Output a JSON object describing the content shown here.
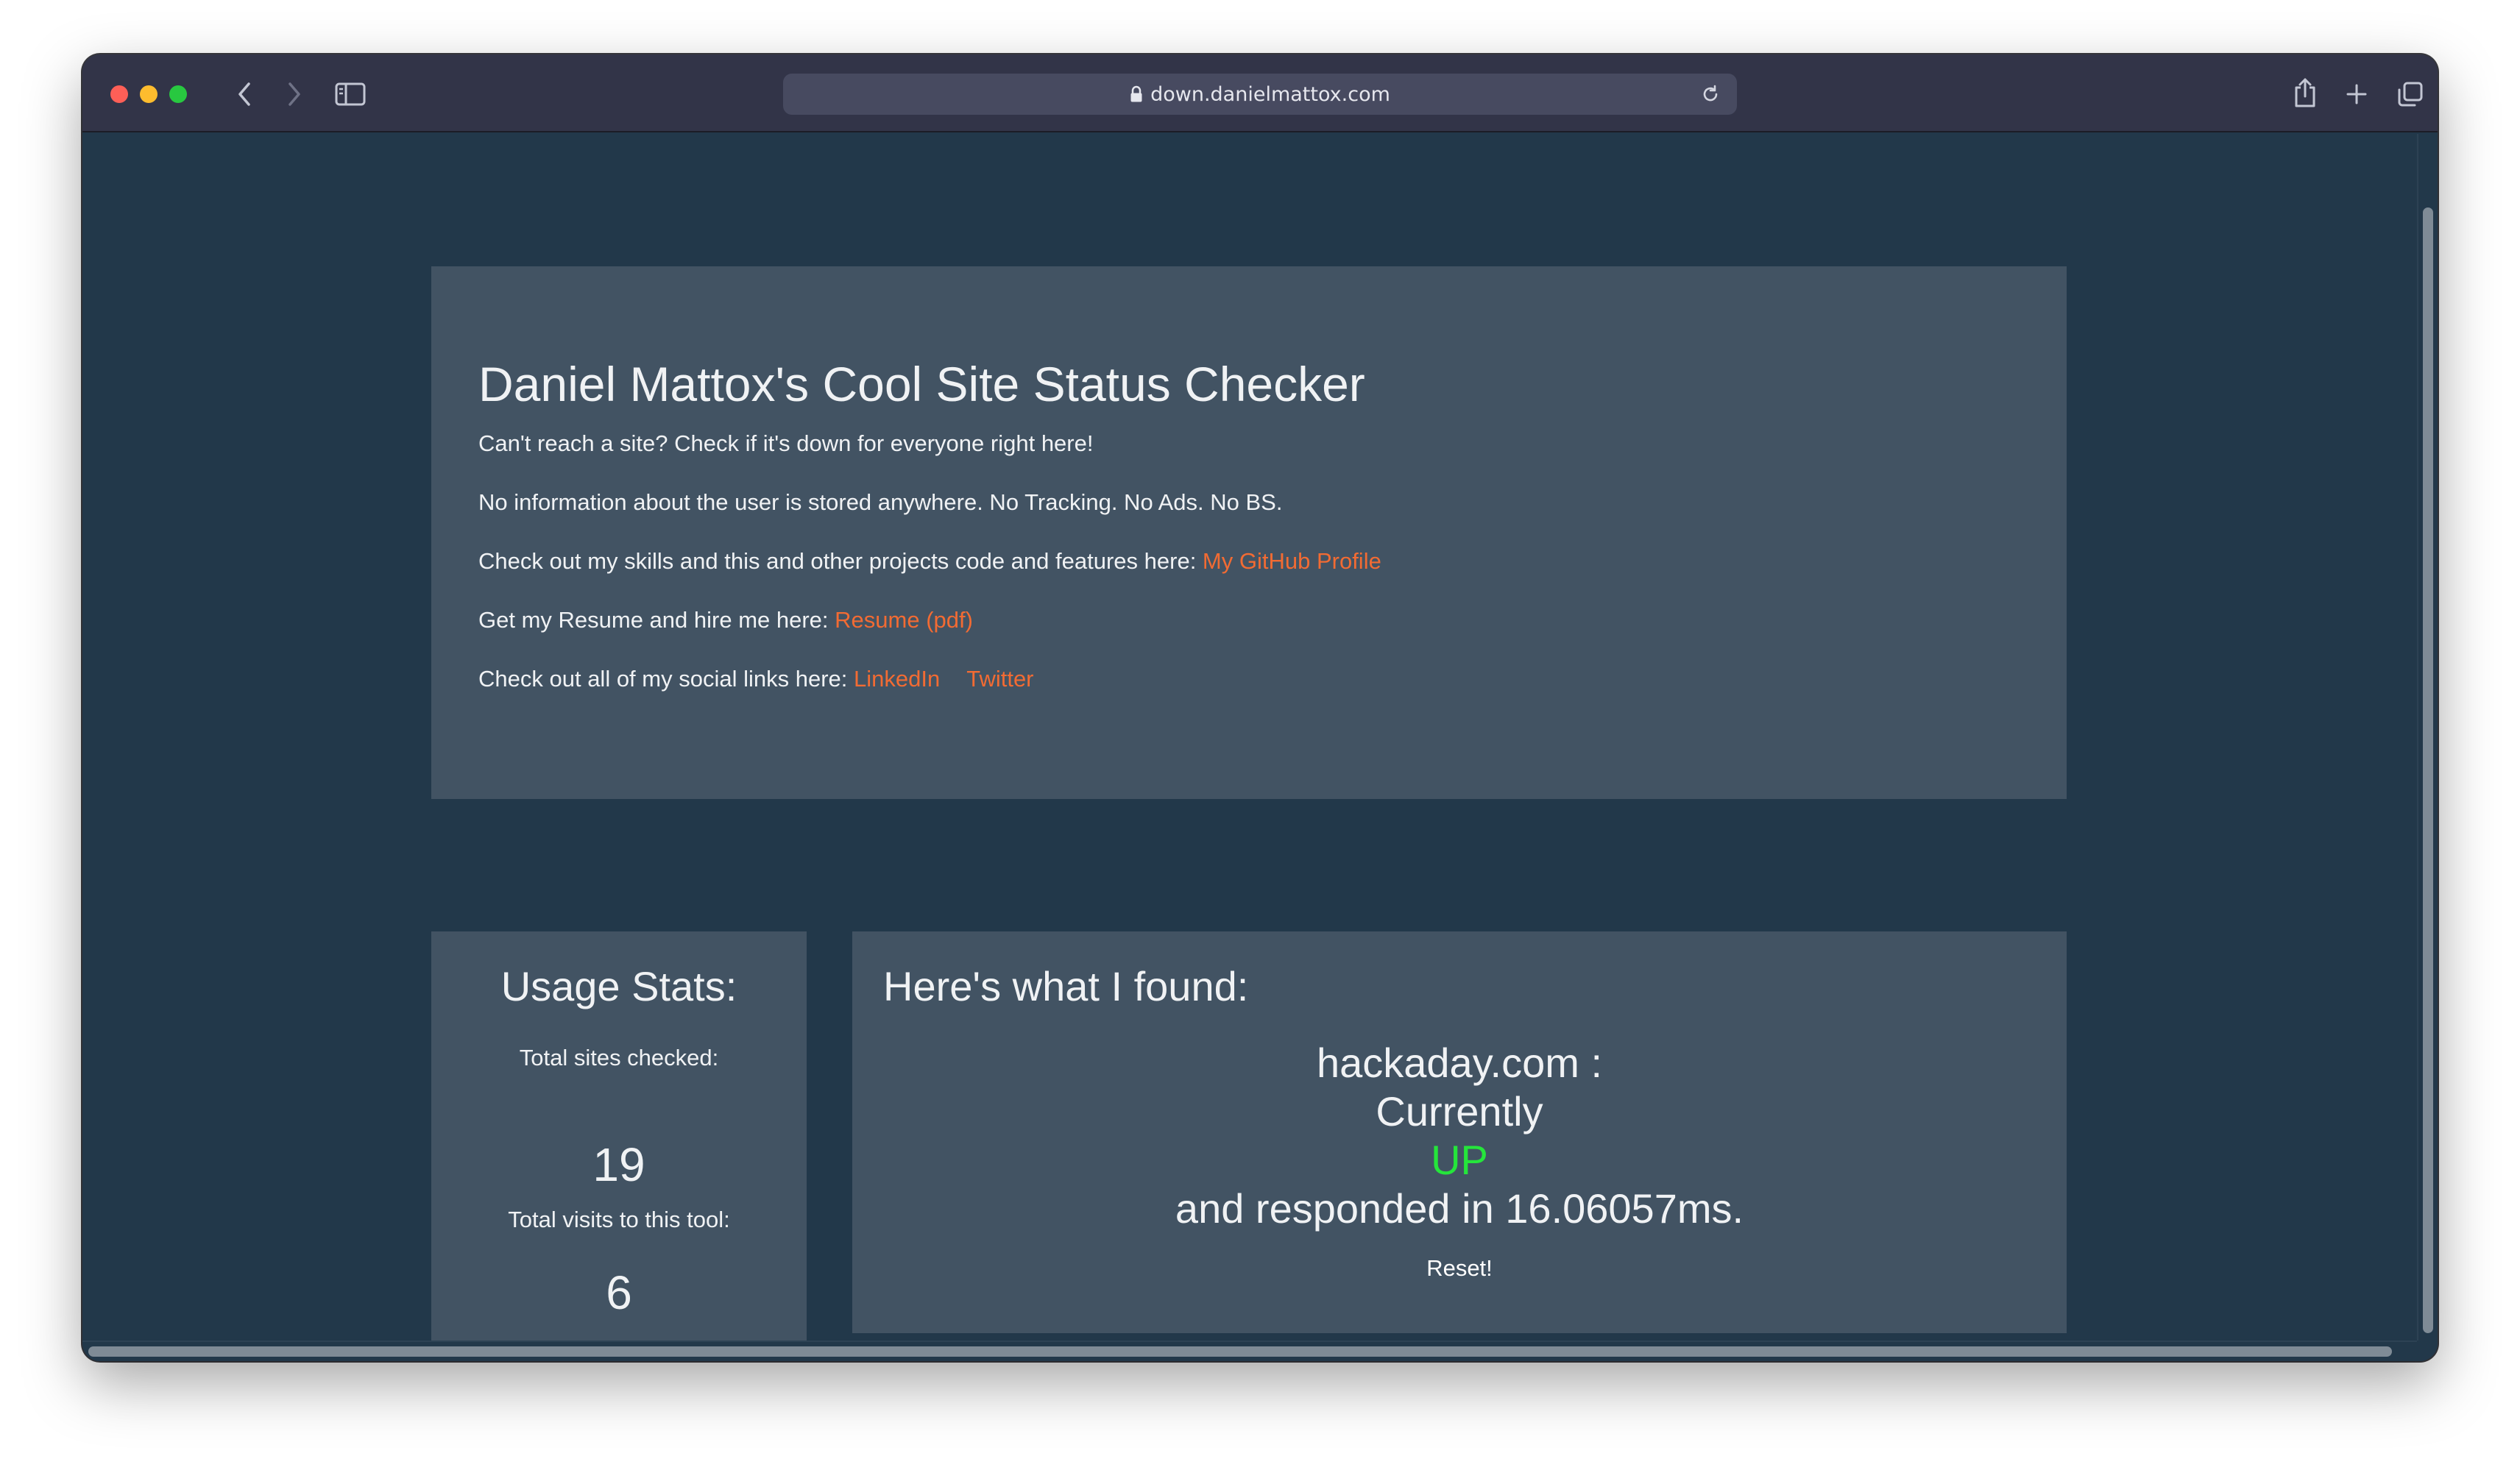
{
  "browser": {
    "url": "down.danielmattox.com",
    "icons": {
      "back": "chevron-left-icon",
      "forward": "chevron-right-icon",
      "sidebar": "sidebar-icon",
      "lock": "lock-icon",
      "reload": "reload-icon",
      "share": "share-icon",
      "new_tab": "plus-icon",
      "tabs_overview": "tabs-icon"
    }
  },
  "intro": {
    "title": "Daniel Mattox's Cool Site Status Checker",
    "line1": "Can't reach a site?  Check if it's down for everyone right here!",
    "line2": "No information about the user is stored anywhere. No Tracking. No Ads. No BS.",
    "line3_text": "Check out my skills and this and other projects code and features here: ",
    "line3_link": "My GitHub Profile",
    "line4_text": "Get my Resume and hire me here: ",
    "line4_link": "Resume (pdf)",
    "line5_text": "Check out all of my social links here: ",
    "line5_link1": "LinkedIn",
    "line5_link2": "Twitter"
  },
  "stats": {
    "title": "Usage Stats:",
    "sites_checked_label": "Total sites checked:",
    "sites_checked_value": "19",
    "visits_label": "Total visits to this tool:",
    "visits_value": "6"
  },
  "result": {
    "title": "Here's what I found:",
    "site": "hackaday.com :",
    "currently": "Currently",
    "status": "UP",
    "response": "and responded in 16.06057ms.",
    "reset": "Reset!"
  },
  "colors": {
    "background": "#22384a",
    "card": "#425363",
    "link": "#f26b33",
    "status_up": "#25e53b"
  }
}
